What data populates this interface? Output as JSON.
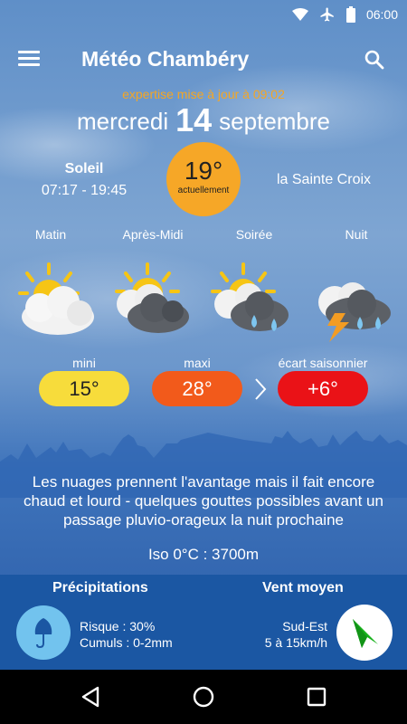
{
  "status_bar": {
    "time": "06:00",
    "icons": [
      "wifi-icon",
      "airplane-icon",
      "battery-icon"
    ]
  },
  "app_bar": {
    "title": "Météo Chambéry",
    "menu_icon": "hamburger-menu-icon",
    "search_icon": "search-icon"
  },
  "header": {
    "update_text": "expertise mise à jour à 09:02",
    "weekday": "mercredi",
    "day": "14",
    "month": "septembre"
  },
  "sun": {
    "label": "Soleil",
    "times": "07:17 - 19:45"
  },
  "current": {
    "temp": "19°",
    "label": "actuellement"
  },
  "saint": "la Sainte Croix",
  "periods": [
    {
      "label": "Matin",
      "icon": "sun-cloud-icon"
    },
    {
      "label": "Après-Midi",
      "icon": "sun-dark-cloud-icon"
    },
    {
      "label": "Soirée",
      "icon": "sun-cloud-rain-icon"
    },
    {
      "label": "Nuit",
      "icon": "storm-rain-icon"
    }
  ],
  "temps": {
    "min_label": "mini",
    "min": "15°",
    "max_label": "maxi",
    "max": "28°",
    "gap_label": "écart saisonnier",
    "gap": "+6°"
  },
  "description": "Les nuages prennent l'avantage mais il fait encore chaud et lourd - quelques gouttes possibles avant un passage pluvio-orageux la nuit prochaine",
  "iso": "Iso 0°C : 3700m",
  "precipitation": {
    "title": "Précipitations",
    "risk": "Risque : 30%",
    "totals": "Cumuls : 0-2mm"
  },
  "wind": {
    "title": "Vent moyen",
    "direction": "Sud-Est",
    "speed": "5 à 15km/h"
  },
  "colors": {
    "accent_orange": "#f6a727",
    "min": "#f7dc3b",
    "max": "#f25a1b",
    "gap": "#ea1217",
    "panel": "#1b57a3"
  }
}
